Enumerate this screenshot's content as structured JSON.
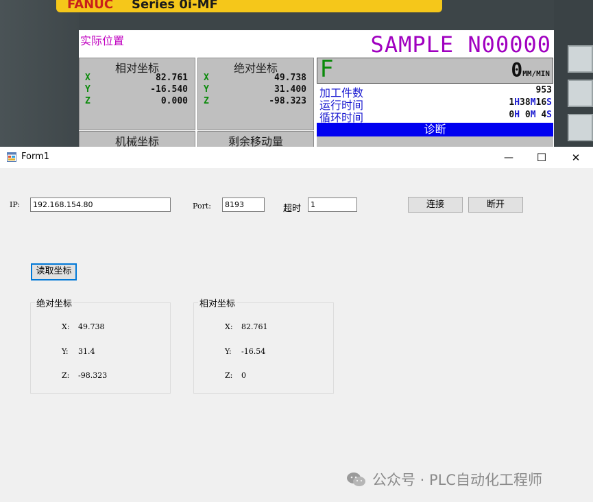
{
  "cnc_panel": {
    "brand": "FANUC",
    "series": "Series 0i-MF",
    "screen_title": "实际位置",
    "program": "SAMPLE N00000",
    "relative": {
      "title": "相对坐标",
      "rows": [
        {
          "axis": "X",
          "value": "82.761"
        },
        {
          "axis": "Y",
          "value": "-16.540"
        },
        {
          "axis": "Z",
          "value": "0.000"
        }
      ]
    },
    "absolute": {
      "title": "绝对坐标",
      "rows": [
        {
          "axis": "X",
          "value": "49.738"
        },
        {
          "axis": "Y",
          "value": "31.400"
        },
        {
          "axis": "Z",
          "value": "-98.323"
        }
      ]
    },
    "machine_title": "机械坐标",
    "remaining_title": "剩余移动量",
    "feed": {
      "label": "F",
      "value": "0",
      "unit": "MM/MIN"
    },
    "parts_count": {
      "label": "加工件数",
      "value": "953"
    },
    "run_time": {
      "label": "运行时间",
      "h": "1",
      "m": "38",
      "s": "16"
    },
    "cycle_time": {
      "label": "循环时间",
      "h": "0",
      "m": "0",
      "s": "4"
    },
    "diag_label": "诊断"
  },
  "window": {
    "title": "Form1",
    "minimize": "—",
    "maximize": "☐",
    "close": "✕"
  },
  "connection": {
    "ip_label": "IP:",
    "ip_value": "192.168.154.80",
    "port_label": "Port:",
    "port_value": "8193",
    "timeout_label": "超时",
    "timeout_value": "1",
    "connect_label": "连接",
    "disconnect_label": "断开"
  },
  "read_button_label": "读取坐标",
  "absolute_group": {
    "title": "绝对坐标",
    "x_label": "X:",
    "x_value": "49.738",
    "y_label": "Y:",
    "y_value": "31.4",
    "z_label": "Z:",
    "z_value": "-98.323"
  },
  "relative_group": {
    "title": "相对坐标",
    "x_label": "X:",
    "x_value": "82.761",
    "y_label": "Y:",
    "y_value": "-16.54",
    "z_label": "Z:",
    "z_value": "0"
  },
  "watermark": "公众号 · PLC自动化工程师",
  "colors": {
    "accent": "#0078d7",
    "fanuc_yellow": "#f5c71a",
    "screen_blue": "#0000f0"
  }
}
